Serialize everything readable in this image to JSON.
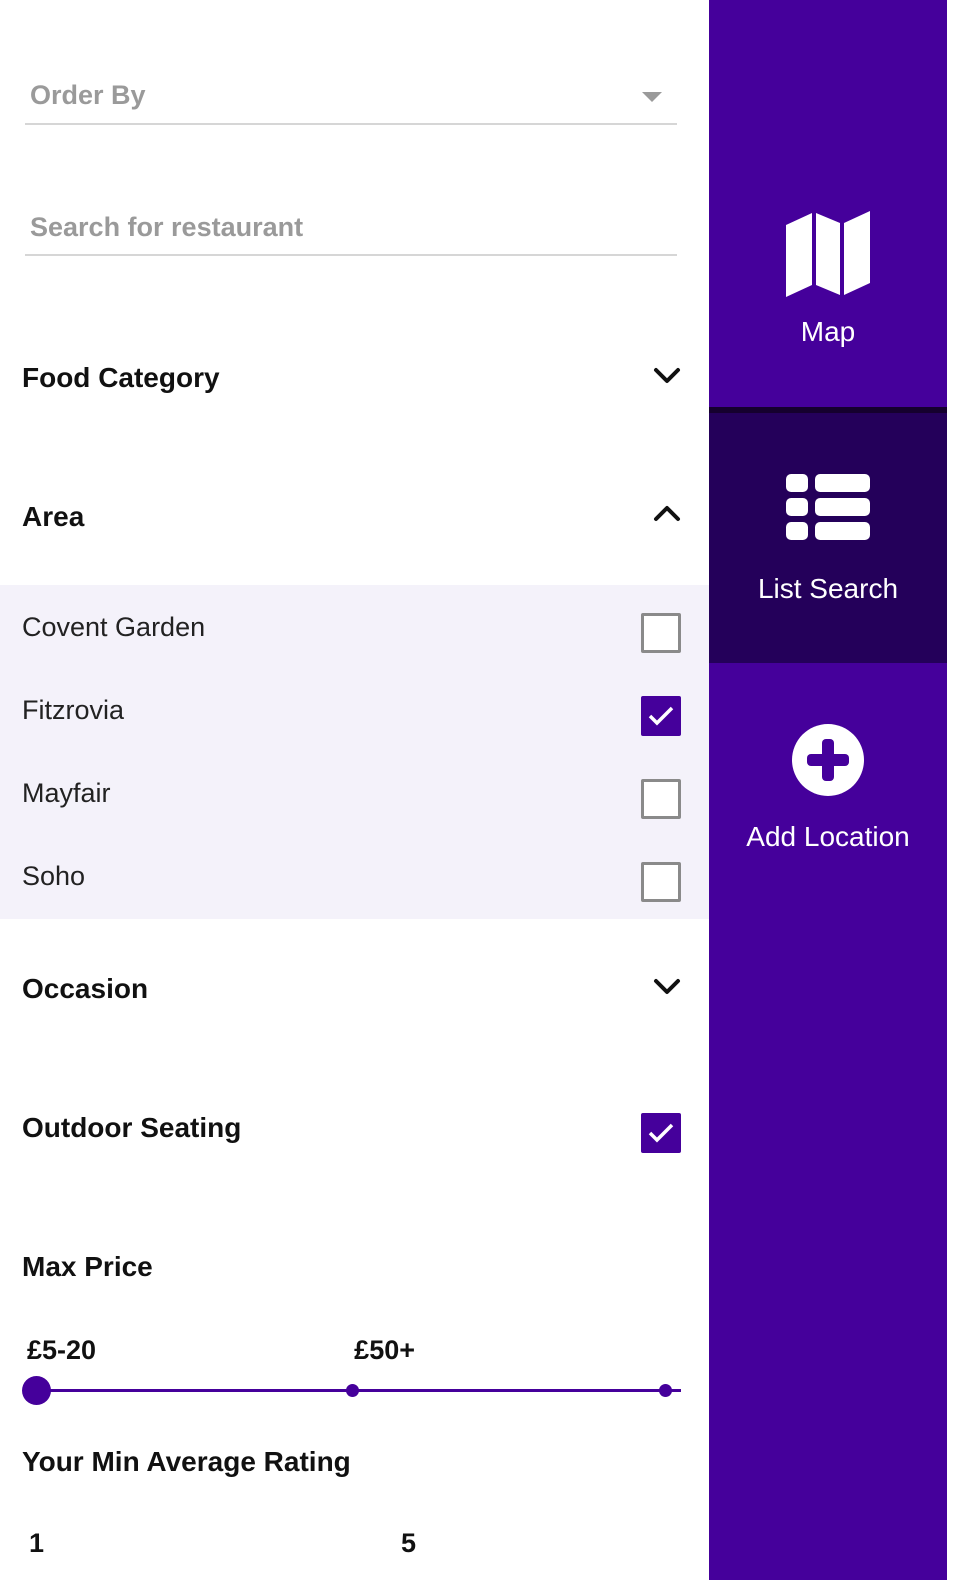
{
  "filters": {
    "order_by_placeholder": "Order By",
    "search_placeholder": "Search for restaurant",
    "food_category": {
      "title": "Food Category",
      "expanded": false
    },
    "area": {
      "title": "Area",
      "expanded": true,
      "items": [
        {
          "label": "Covent Garden",
          "checked": false
        },
        {
          "label": "Fitzrovia",
          "checked": true
        },
        {
          "label": "Mayfair",
          "checked": false
        },
        {
          "label": "Soho",
          "checked": false
        }
      ]
    },
    "occasion": {
      "title": "Occasion",
      "expanded": false
    },
    "outdoor_seating": {
      "title": "Outdoor Seating",
      "checked": true
    },
    "max_price": {
      "title": "Max Price",
      "min_label": "£5-20",
      "max_label": "£50+",
      "steps": 3,
      "selected_step": 0
    },
    "min_rating": {
      "title": "Your Min Average Rating",
      "min_label": "1",
      "max_label": "5"
    }
  },
  "nav": {
    "map": {
      "label": "Map",
      "icon": "map-icon",
      "active": false
    },
    "list_search": {
      "label": "List Search",
      "icon": "list-icon",
      "active": true
    },
    "add_location": {
      "label": "Add Location",
      "icon": "plus-circle-icon",
      "active": false
    }
  },
  "colors": {
    "accent": "#45009b",
    "nav_active": "#24005a",
    "area_background": "#f4f2fa"
  }
}
